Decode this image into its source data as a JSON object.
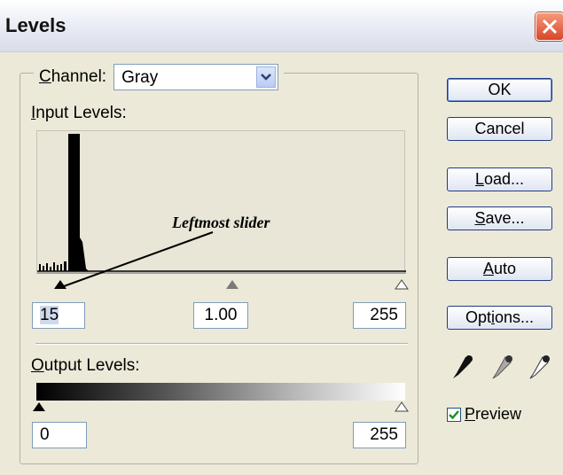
{
  "window": {
    "title": "Levels",
    "close_icon": "close-icon"
  },
  "channel": {
    "label_prefix": "",
    "label_ul": "C",
    "label_rest": "hannel:",
    "selected": "Gray"
  },
  "input_levels": {
    "label_ul": "I",
    "label_rest": "nput Levels:",
    "black": "15",
    "gamma": "1.00",
    "white": "255"
  },
  "annotation": {
    "text": "Leftmost slider"
  },
  "output_levels": {
    "label_ul": "O",
    "label_rest": "utput Levels:",
    "black": "0",
    "white": "255"
  },
  "buttons": {
    "ok": "OK",
    "cancel": "Cancel",
    "load_ul": "L",
    "load_rest": "oad...",
    "save_ul": "S",
    "save_rest": "ave...",
    "auto_ul": "A",
    "auto_rest": "uto",
    "options_pre": "Opt",
    "options_ul": "i",
    "options_rest": "ons..."
  },
  "preview": {
    "label_ul": "P",
    "label_rest": "review",
    "checked": true
  },
  "colors": {
    "dialog_bg": "#ece9d8",
    "button_border": "#1f3c86",
    "field_border": "#7f9db9",
    "close_red": "#d8462a"
  }
}
